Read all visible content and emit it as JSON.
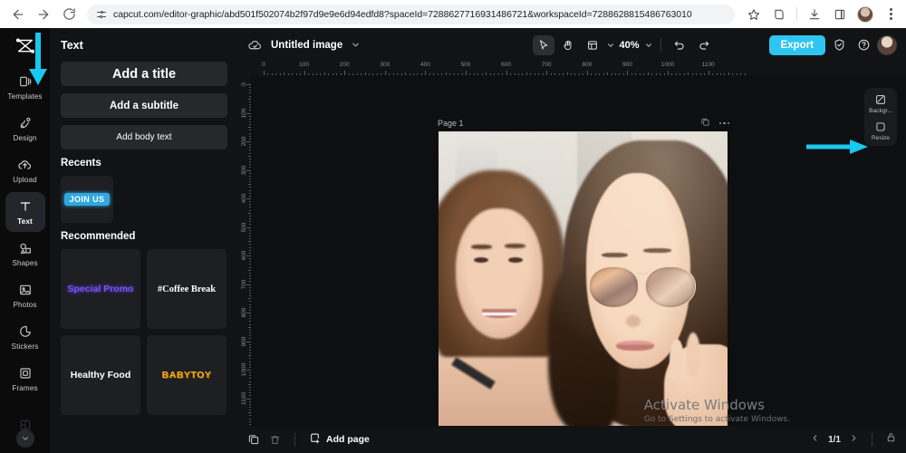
{
  "browser": {
    "url": "capcut.com/editor-graphic/abd501f502074b2f97d9e9e6d94edfd8?spaceId=7288627716931486721&workspaceId=7288628815486763010",
    "icons": [
      "back-icon",
      "forward-icon",
      "reload-icon",
      "site-settings-icon",
      "bookmark-star-icon",
      "side-panel-icon",
      "downloads-icon",
      "split-view-icon",
      "profile-avatar",
      "chrome-menu-icon"
    ]
  },
  "rail": {
    "logo": "capcut-logo",
    "items": [
      {
        "label": "Templates",
        "icon": "templates-icon",
        "active": false
      },
      {
        "label": "Design",
        "icon": "design-icon",
        "active": false
      },
      {
        "label": "Upload",
        "icon": "upload-cloud-icon",
        "active": false
      },
      {
        "label": "Text",
        "icon": "text-icon",
        "active": true
      },
      {
        "label": "Shapes",
        "icon": "shapes-icon",
        "active": false
      },
      {
        "label": "Photos",
        "icon": "photos-icon",
        "active": false
      },
      {
        "label": "Stickers",
        "icon": "stickers-icon",
        "active": false
      },
      {
        "label": "Frames",
        "icon": "frames-icon",
        "active": false
      }
    ],
    "expand_label": "chevron-down-icon"
  },
  "panel": {
    "title": "Text",
    "buttons": [
      {
        "label": "Add a title",
        "style": "title"
      },
      {
        "label": "Add a subtitle",
        "style": "subtitle"
      },
      {
        "label": "Add body text",
        "style": "body"
      }
    ],
    "recents_title": "Recents",
    "recents": [
      {
        "label": "JOIN US"
      }
    ],
    "recommended_title": "Recommended",
    "recommended": [
      {
        "label": "Special Promo",
        "style": "s-promo"
      },
      {
        "label": "#Coffee Break",
        "style": "s-coffee"
      },
      {
        "label": "Healthy Food",
        "style": "s-healthy"
      },
      {
        "label": "BABYTOY",
        "style": "s-baby"
      }
    ]
  },
  "topbar": {
    "cloud_icon": "cloud-saved-icon",
    "doc_title": "Untitled image",
    "title_chevron": "chevron-down-icon",
    "select_tool": "cursor-select-icon",
    "hand_tool": "hand-pan-icon",
    "layout_tool": "layout-panel-icon",
    "zoom_value": "40%",
    "undo": "undo-icon",
    "redo": "redo-icon",
    "export_label": "Export",
    "shield_icon": "shield-check-icon",
    "help_icon": "help-question-icon",
    "avatar": "user-avatar"
  },
  "rulers": {
    "h_ticks": [
      "0",
      "100",
      "200",
      "300",
      "400",
      "500",
      "600",
      "700",
      "800",
      "900",
      "1000",
      "1100"
    ],
    "v_ticks": [
      "0",
      "100",
      "200",
      "300",
      "400",
      "500",
      "600",
      "700",
      "800",
      "900",
      "1000",
      "1100"
    ]
  },
  "page": {
    "name": "Page 1",
    "duplicate_icon": "duplicate-page-icon",
    "more_icon": "more-options-icon"
  },
  "right_tools": [
    {
      "label": "Backgr...",
      "icon": "background-icon"
    },
    {
      "label": "Resize",
      "icon": "resize-icon"
    }
  ],
  "watermark": {
    "title": "Activate Windows",
    "subtitle": "Go to Settings to activate Windows."
  },
  "bottombar": {
    "duplicate_icon": "duplicate-icon",
    "delete_icon": "trash-icon",
    "add_page_label": "Add page",
    "add_page_icon": "add-page-icon",
    "prev_icon": "chevron-left-icon",
    "page_count": "1/1",
    "next_icon": "chevron-right-icon",
    "lock_icon": "unlock-icon"
  },
  "annotations": {
    "accent": "#17c8ef",
    "arrows": [
      {
        "name": "arrow-to-templates",
        "direction": "down"
      },
      {
        "name": "arrow-to-resize",
        "direction": "right"
      }
    ]
  }
}
